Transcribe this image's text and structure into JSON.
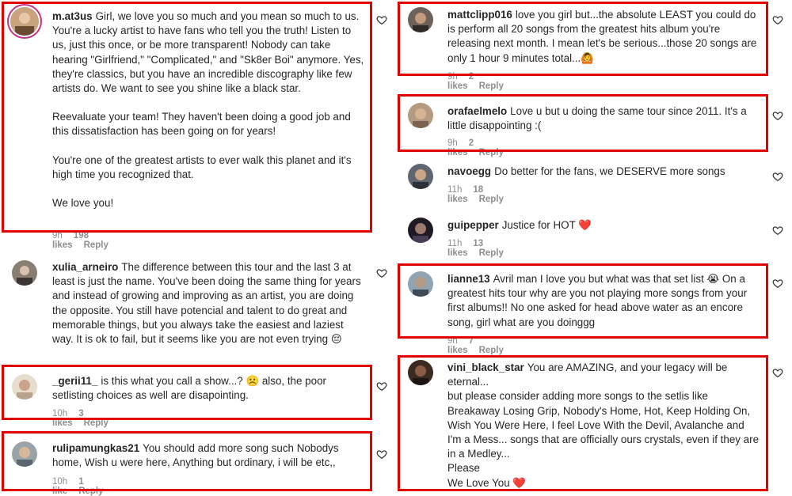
{
  "comments": [
    {
      "user": "m.at3us",
      "paragraphs": [
        "Girl, we love you so much and you mean so much to us. You're a lucky artist to have fans who tell you the truth! Listen to us, just this once, or be more transparent! Nobody can take hearing \"Girlfriend,\" \"Complicated,\" and \"Sk8er Boi\" anymore. Yes, they're classics, but you have an incredible discography like few artists do. We want to see you shine like a black star.",
        "Reevaluate your team! They haven't been doing a good job and this dissatisfaction has been going on for years!",
        "You're one of the greatest artists to ever walk this planet and it's high time you recognized that.",
        "We love you!"
      ],
      "time": "9h",
      "likes": "198 likes",
      "reply": "Reply"
    },
    {
      "user": "xulia_arneiro",
      "paragraphs": [
        "The difference between this tour and the last 3 at least is just the name. You've been doing the same thing for years and instead of growing and improving as an artist, you are doing the opposite. You still have potencial and talent to do great and memorable things, but you always take the easiest and laziest way. It is ok to fail, but it seems like you are not even trying 😔"
      ]
    },
    {
      "user": "_gerii11_",
      "paragraphs": [
        "is this what you call a show...? ☹️ also, the poor setlisting choices as well are disapointing."
      ],
      "time": "10h",
      "likes": "3 likes",
      "reply": "Reply"
    },
    {
      "user": "rulipamungkas21",
      "paragraphs": [
        "You should add more song such Nobodys home, Wish u were here, Anything but ordinary, i will be etc,,"
      ],
      "time": "10h",
      "likes": "1 like",
      "reply": "Reply"
    },
    {
      "user": "mattclipp016",
      "paragraphs": [
        "love you girl but...the absolute LEAST you could do is perform all 20 songs from the greatest hits album you're releasing next month. I mean let's be serious...those 20 songs are only 1 hour 9 minutes total...🙆"
      ],
      "time": "9h",
      "likes": "2 likes",
      "reply": "Reply"
    },
    {
      "user": "orafaelmelo",
      "paragraphs": [
        "Love u but u doing the same tour since 2011. It's a little disappointing :("
      ],
      "time": "9h",
      "likes": "2 likes",
      "reply": "Reply"
    },
    {
      "user": "navoegg",
      "paragraphs": [
        "Do better for the fans, we DESERVE more songs"
      ],
      "time": "11h",
      "likes": "18 likes",
      "reply": "Reply"
    },
    {
      "user": "guipepper",
      "paragraphs": [
        "Justice for HOT ❤️"
      ],
      "time": "11h",
      "likes": "13 likes",
      "reply": "Reply"
    },
    {
      "user": "lianne13",
      "paragraphs": [
        "Avril man I love you but what was that set list 😭 On a greatest hits tour why are you not playing more songs from your first albums!! No one asked for head above water as an encore song, girl what are you doinggg"
      ],
      "time": "9h",
      "likes": "7 likes",
      "reply": "Reply"
    },
    {
      "user": "vini_black_star",
      "paragraphs": [
        "You are AMAZING, and your legacy will be eternal...",
        "but please consider adding more songs to the setlis like Breakaway Losing Grip, Nobody's Home, Hot, Keep Holding On, Wish You Were Here, I feel Love With the Devil, Avalanche and I'm a Mess... songs that are officially ours crystals, even if they are in a Medley...",
        "Please",
        "We Love You ❤️"
      ]
    }
  ],
  "colors": {
    "highlight": "#e00000",
    "heart": "#e0245e",
    "meta": "#8e8e8e"
  }
}
